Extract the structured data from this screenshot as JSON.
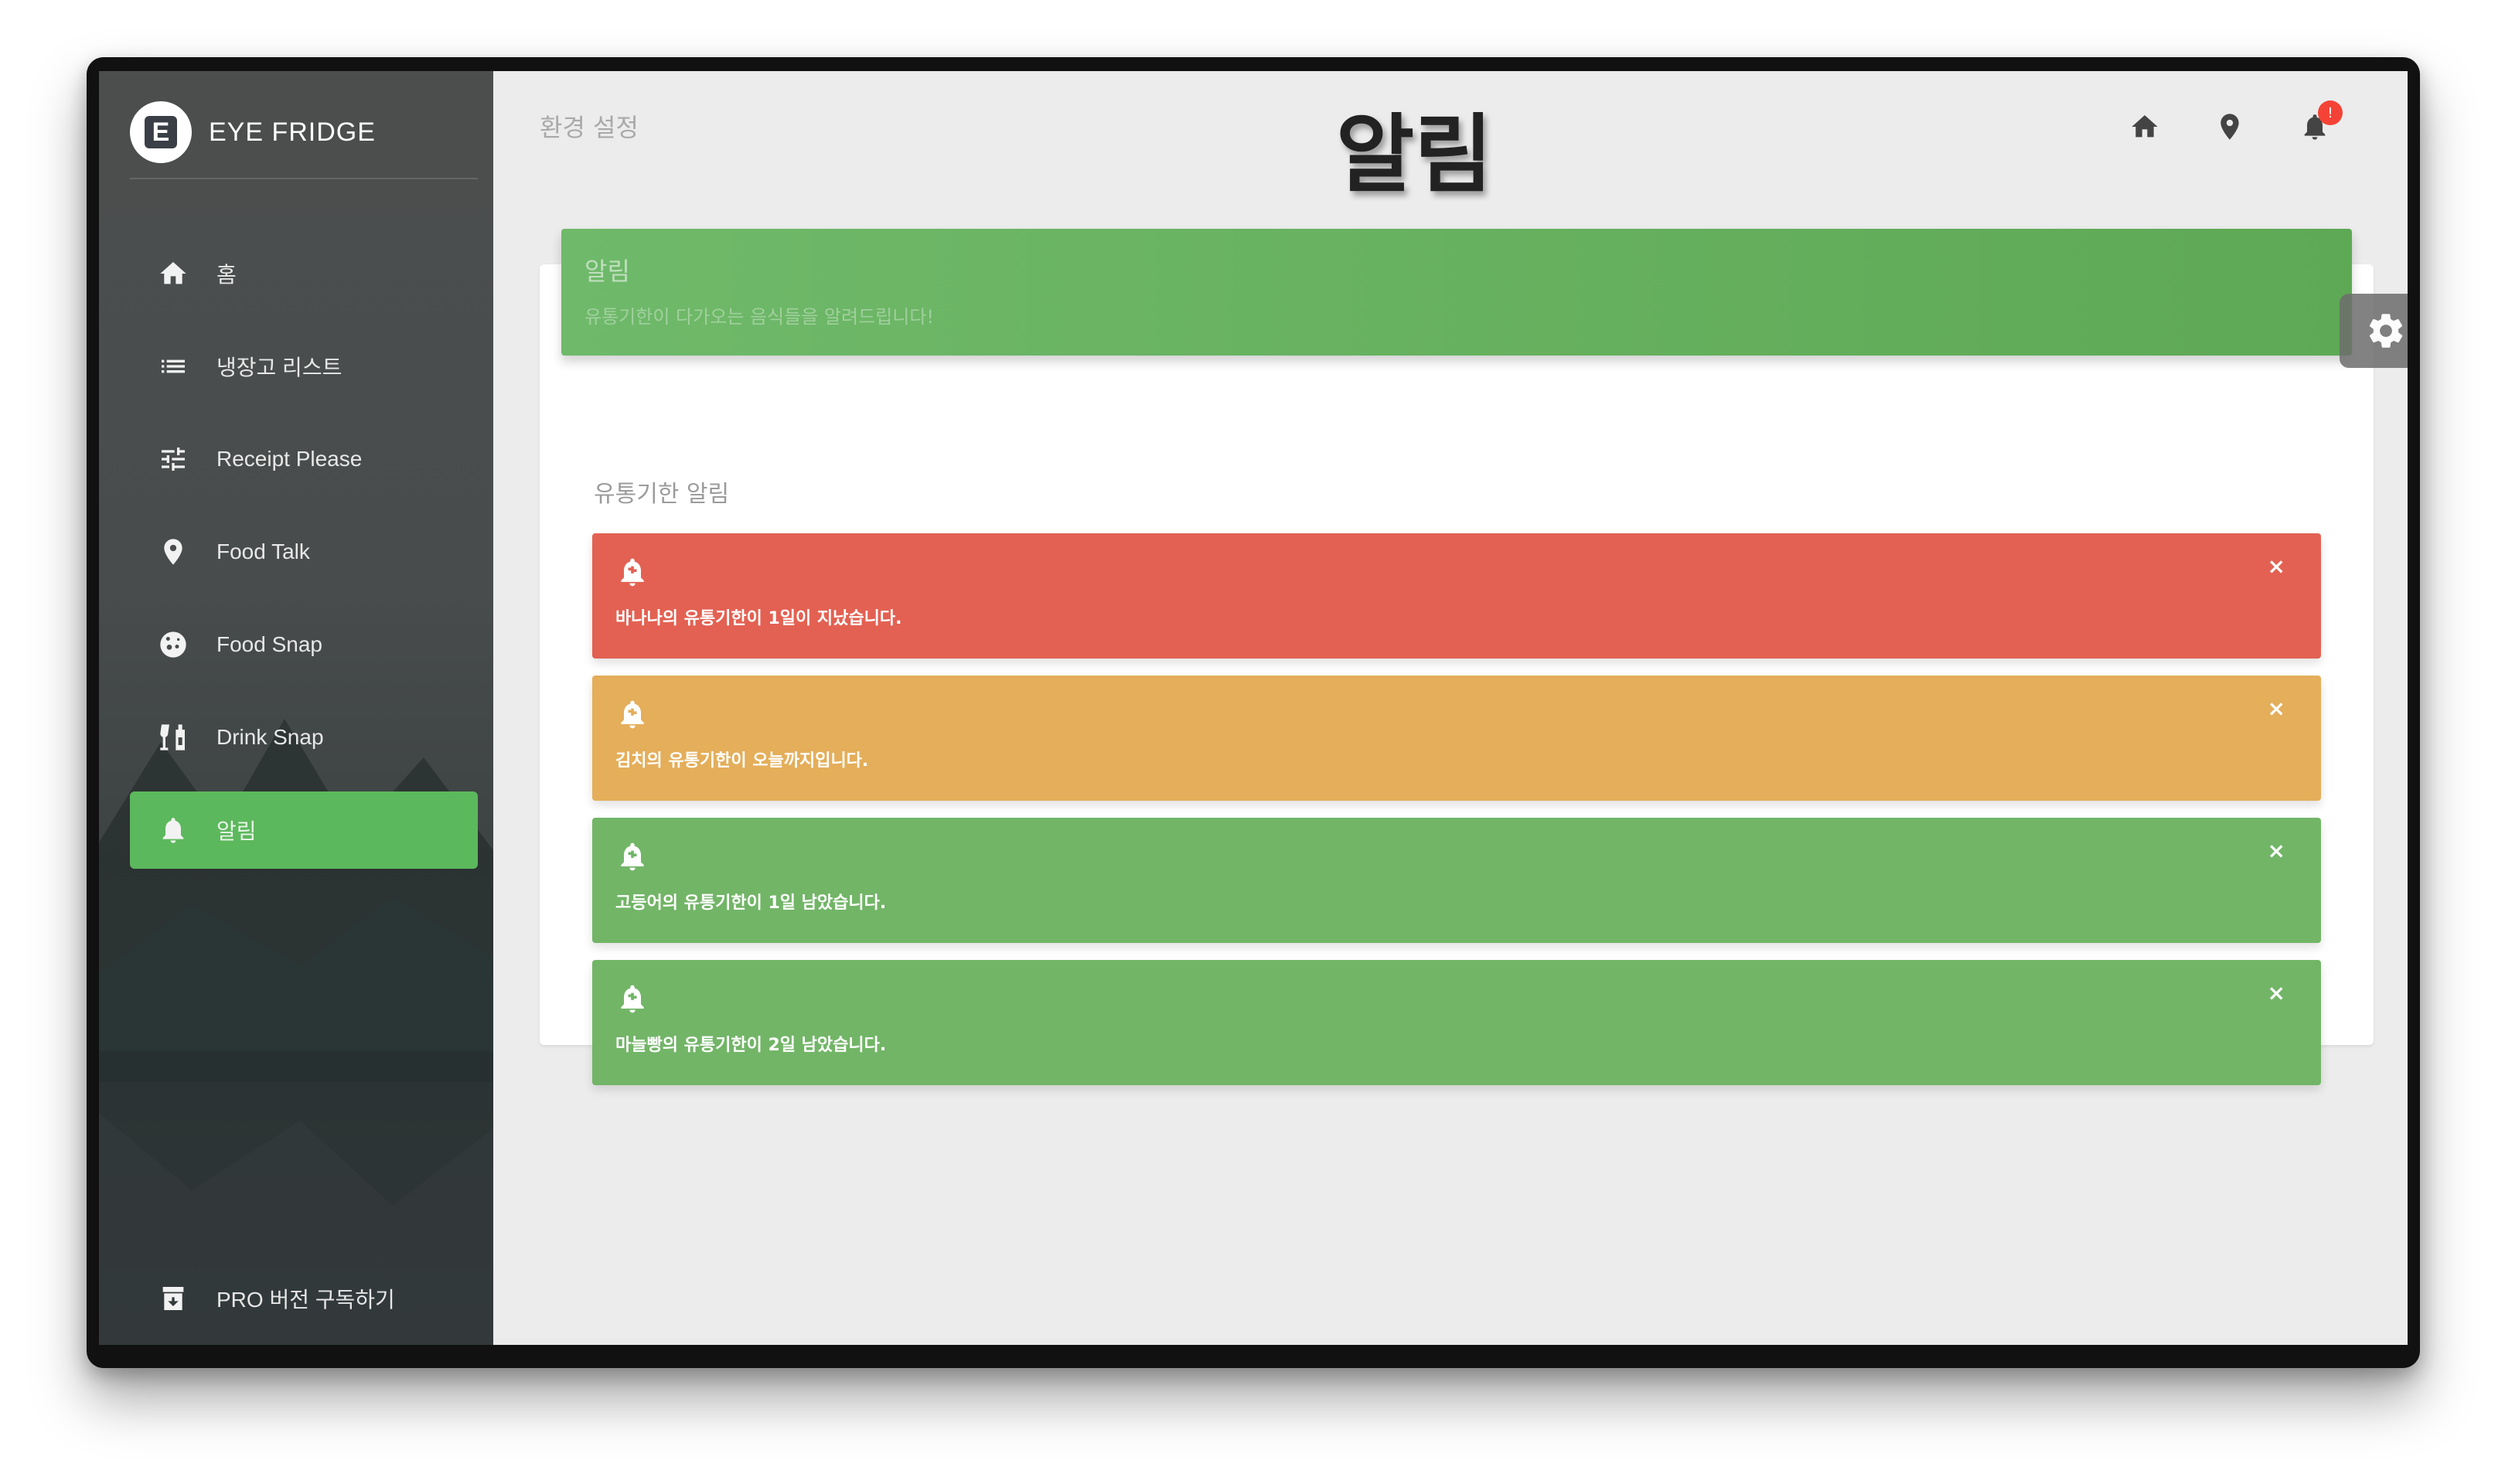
{
  "brand": {
    "name": "EYE FRIDGE",
    "logo_letter": "E"
  },
  "sidebar": {
    "items": [
      {
        "label": "홈",
        "icon": "home-icon",
        "active": false
      },
      {
        "label": "냉장고 리스트",
        "icon": "list-icon",
        "active": false
      },
      {
        "label": "Receipt Please",
        "icon": "sliders-icon",
        "active": false
      },
      {
        "label": "Food Talk",
        "icon": "location-pin-icon",
        "active": false
      },
      {
        "label": "Food Snap",
        "icon": "cookie-icon",
        "active": false
      },
      {
        "label": "Drink Snap",
        "icon": "drinks-icon",
        "active": false
      },
      {
        "label": "알림",
        "icon": "bell-icon",
        "active": true
      }
    ],
    "pro_label": "PRO 버전 구독하기"
  },
  "topbar": {
    "settings_label": "환경 설정",
    "page_title": "알림",
    "notification_count": "!"
  },
  "card": {
    "title": "알림",
    "subtitle": "유통기한이 다가오는 음식들을 알려드립니다!",
    "section_label": "유통기한 알림"
  },
  "alerts": [
    {
      "message": "바나나의 유통기한이 1일이 지났습니다.",
      "color": "#e36152",
      "close": "×"
    },
    {
      "message": "김치의 유통기한이 오늘까지입니다.",
      "color": "#e4ae5a",
      "close": "×"
    },
    {
      "message": "고등어의 유통기한이 1일 남았습니다.",
      "color": "#72b567",
      "close": "×"
    },
    {
      "message": "마늘빵의 유통기한이 2일 남았습니다.",
      "color": "#72b567",
      "close": "×"
    }
  ]
}
